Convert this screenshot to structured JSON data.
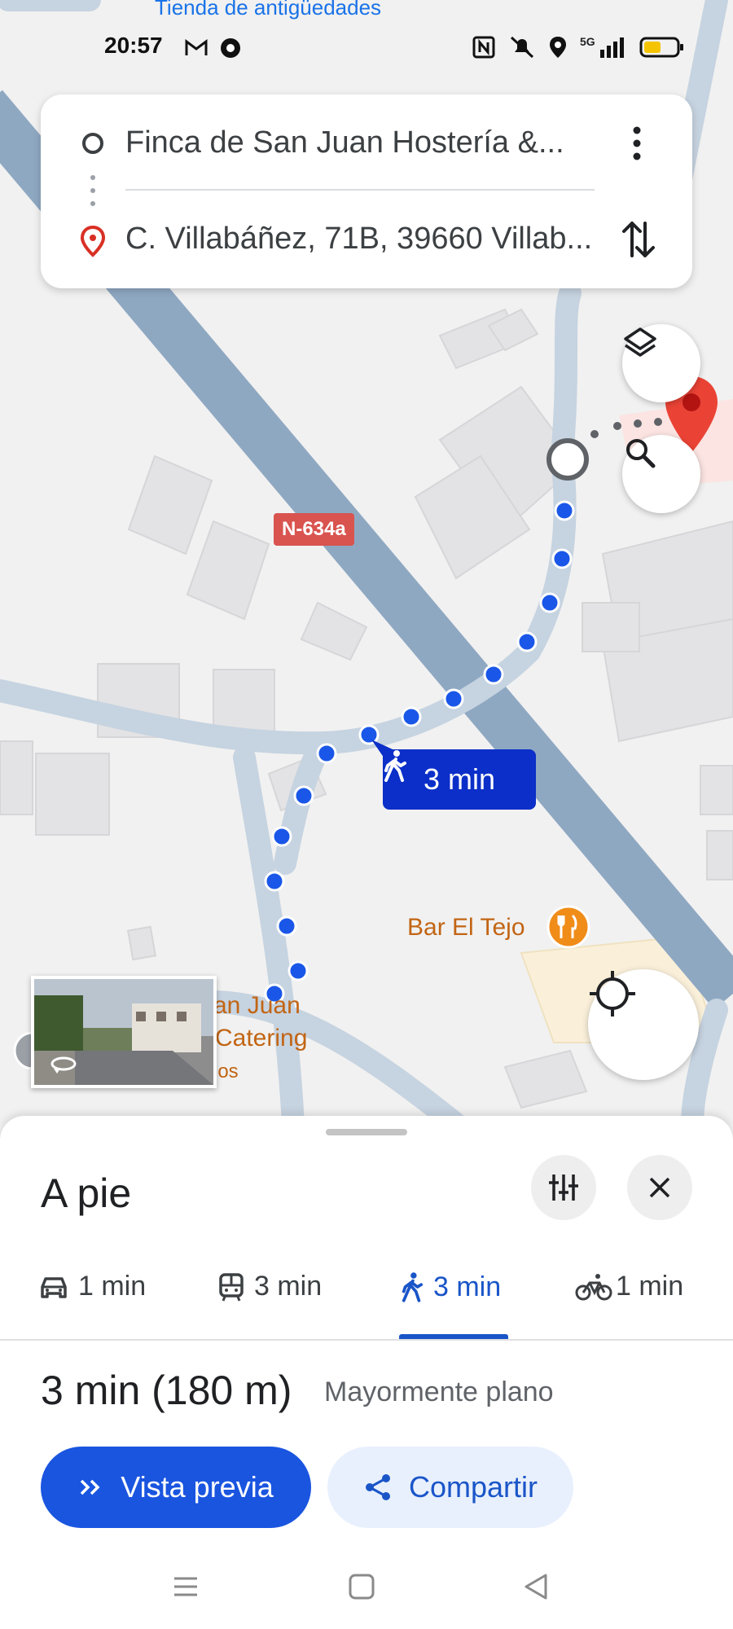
{
  "status_bar": {
    "time": "20:57",
    "network": "5G",
    "icons": [
      "gmail-icon",
      "chrome-icon",
      "nfc-icon",
      "mute-icon",
      "location-icon",
      "signal-icon",
      "battery-icon"
    ]
  },
  "map": {
    "poi_top": "Tienda de antigüedades",
    "road_shield": "N-634a",
    "route_badge": "3 min",
    "bar_label": "Bar El Tejo",
    "poi_partial_1": "an Juan",
    "poi_partial_2": "Catering",
    "poi_partial_3": "los",
    "colors": {
      "route": "#1a57e8",
      "road": "#8fa8c2",
      "badge": "#0b2fc8",
      "poi": "#c26514"
    }
  },
  "directions": {
    "origin": "Finca de San Juan Hostería &...",
    "destination": "C. Villabáñez, 71B, 39660 Villab..."
  },
  "sheet": {
    "title": "A pie",
    "modes": [
      {
        "icon": "car-icon",
        "label": "1 min"
      },
      {
        "icon": "transit-icon",
        "label": "3 min"
      },
      {
        "icon": "walk-icon",
        "label": "3 min",
        "active": true
      },
      {
        "icon": "bike-icon",
        "label": "1 min"
      }
    ],
    "summary": "3 min (180 m)",
    "summary_detail": "Mayormente plano",
    "preview_label": "Vista previa",
    "share_label": "Compartir",
    "accent": "#1a55c8"
  }
}
